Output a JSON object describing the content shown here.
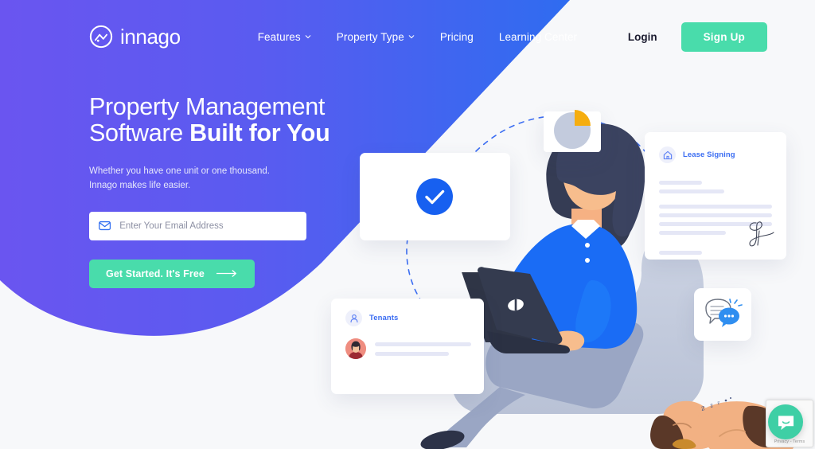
{
  "brand": {
    "name": "innago",
    "logo_icon": "innago-circle-mountain-logo",
    "accent_green": "#49dcab",
    "accent_blue": "#2f6cf0",
    "accent_purple": "#6058ef"
  },
  "nav": {
    "items": [
      {
        "label": "Features",
        "has_dropdown": true,
        "icon": "chevron-down-icon"
      },
      {
        "label": "Property Type",
        "has_dropdown": true,
        "icon": "chevron-down-icon"
      },
      {
        "label": "Pricing",
        "has_dropdown": false
      },
      {
        "label": "Learning Center",
        "has_dropdown": false
      }
    ],
    "login_label": "Login",
    "signup_label": "Sign Up"
  },
  "hero": {
    "heading_regular": "Property Management\nSoftware ",
    "heading_bold": "Built for You",
    "subtext": "Whether you have one unit or one thousand.\nInnago makes life easier.",
    "email_placeholder": "Enter Your Email Address",
    "email_value": "",
    "email_icon": "envelope-icon",
    "cta_label": "Get Started. It's Free",
    "cta_icon": "arrow-right-icon"
  },
  "illustration": {
    "check_card": {
      "icon": "check-circle-icon"
    },
    "pie_card": {
      "icon": "pie-chart-icon",
      "slice_color": "#f5ad0f",
      "base_color": "#c3cbdd"
    },
    "lease_card": {
      "title": "Lease Signing",
      "icon": "house-icon",
      "signature_icon": "signature-scribble-icon"
    },
    "tenants_card": {
      "title": "Tenants",
      "icon": "person-icon",
      "avatar_icon": "tenant-avatar"
    },
    "chat_card": {
      "icon": "speech-bubbles-icon"
    },
    "person": {
      "icon": "woman-with-laptop-illustration"
    },
    "dog": {
      "icon": "sleeping-dog-illustration",
      "sleep_text": "z z z"
    }
  },
  "widgets": {
    "recaptcha": {
      "label": "Privacy - Terms",
      "icon": "recaptcha-badge-icon"
    },
    "chat_button": {
      "icon": "chat-smile-icon"
    }
  }
}
